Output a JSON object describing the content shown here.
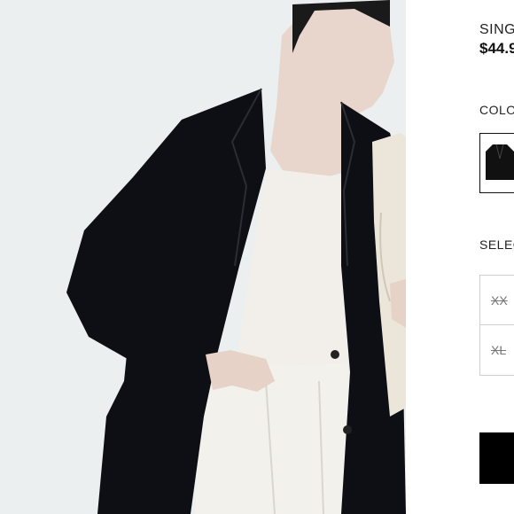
{
  "product": {
    "title": "SING",
    "price": "$44.9"
  },
  "color": {
    "label": "COLO",
    "selected_swatch": "black-blazer-thumbnail"
  },
  "size": {
    "label": "SELEC",
    "options": [
      {
        "label": "XX",
        "available": false
      },
      {
        "label": "XL",
        "available": false
      }
    ]
  },
  "add_button": {
    "label": ""
  },
  "colors": {
    "blazer": "#0d0f14",
    "background": "#eceff0",
    "button": "#000000"
  }
}
